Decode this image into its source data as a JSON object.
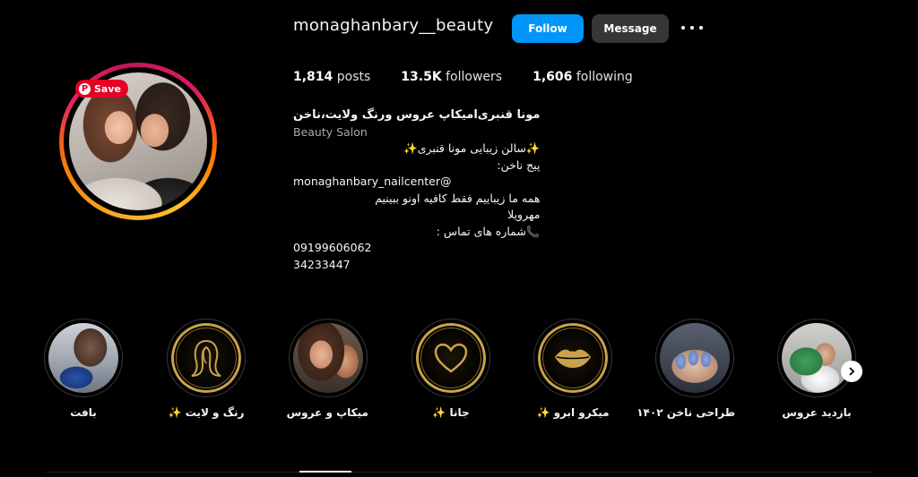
{
  "header": {
    "username": "monaghanbary__beauty",
    "follow_label": "Follow",
    "message_label": "Message"
  },
  "stats": {
    "posts_count": "1,814",
    "posts_label": "posts",
    "followers_count": "13.5K",
    "followers_label": "followers",
    "following_count": "1,606",
    "following_label": "following"
  },
  "save_badge": "Save",
  "bio": {
    "name": "مونا قنبری‌امیکاپ عروس ورنگ ولایت،ناخن",
    "category": "Beauty Salon",
    "lines": [
      "✨سالن زیبایی مونا قنبری✨",
      "پیج ناخن:",
      "monaghanbary_nailcenter@",
      "همه ما زیباییم فقط کافیه اونو ببینیم",
      "مهرویلا",
      "📞شماره های تماس :",
      "09199606062",
      "34233447"
    ]
  },
  "highlights": [
    {
      "label": "بافت"
    },
    {
      "label": "رنگ و لایت ✨"
    },
    {
      "label": "میکاپ و عروس"
    },
    {
      "label": "جانا ✨"
    },
    {
      "label": "میکرو ابرو ✨"
    },
    {
      "label": "طراحی ناخن ۱۴۰۲"
    },
    {
      "label": "بازدید عروس"
    }
  ],
  "colors": {
    "follow_button": "#0095f6",
    "message_button": "#363636",
    "save_badge": "#e60023",
    "gold": "#c9a24b"
  }
}
